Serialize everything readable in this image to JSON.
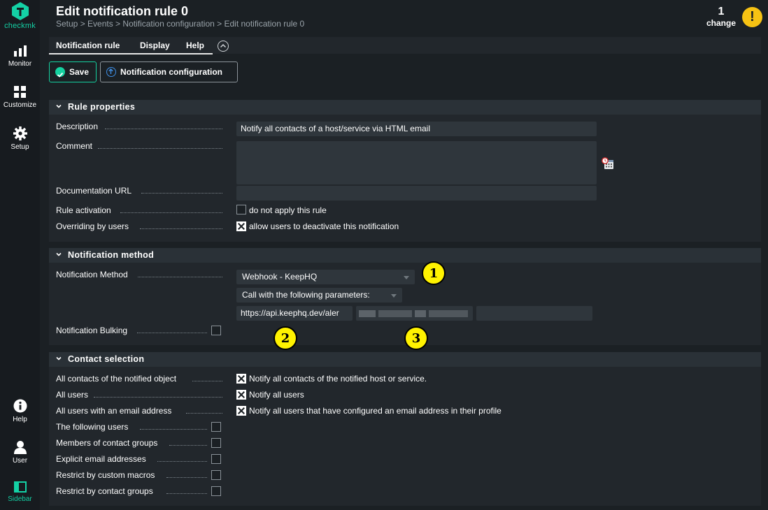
{
  "app": {
    "logo_text": "checkmk"
  },
  "sidebar": {
    "top_items": [
      {
        "label": "Monitor",
        "icon": "bar-chart-icon"
      },
      {
        "label": "Customize",
        "icon": "grid-icon"
      },
      {
        "label": "Setup",
        "icon": "gear-icon"
      }
    ],
    "bottom_items": [
      {
        "label": "Help",
        "icon": "info-icon"
      },
      {
        "label": "User",
        "icon": "user-icon"
      },
      {
        "label": "Sidebar",
        "icon": "sidebar-icon"
      }
    ]
  },
  "header": {
    "title": "Edit notification rule 0",
    "breadcrumb": "Setup > Events > Notification configuration > Edit notification rule 0",
    "changes_count": "1",
    "changes_label": "change"
  },
  "menubar": {
    "items": [
      "Notification rule",
      "Display",
      "Help"
    ]
  },
  "buttons": {
    "save": "Save",
    "config": "Notification configuration"
  },
  "rule_properties": {
    "title": "Rule properties",
    "description_label": "Description",
    "description_value": "Notify all contacts of a host/service via HTML email",
    "comment_label": "Comment",
    "comment_value": "",
    "doc_url_label": "Documentation URL",
    "doc_url_value": "",
    "activation_label": "Rule activation",
    "activation_option": "do not apply this rule",
    "activation_checked": false,
    "overriding_label": "Overriding by users",
    "overriding_option": "allow users to deactivate this notification",
    "overriding_checked": true
  },
  "notification_method": {
    "title": "Notification method",
    "method_label": "Notification Method",
    "method_value": "Webhook - KeepHQ",
    "params_value": "Call with the following parameters:",
    "url_value": "https://api.keephq.dev/aler",
    "bulking_label": "Notification Bulking",
    "bulking_checked": false
  },
  "contact_selection": {
    "title": "Contact selection",
    "rows": [
      {
        "label": "All contacts of the notified object",
        "option": "Notify all contacts of the notified host or service.",
        "checked": true
      },
      {
        "label": "All users",
        "option": "Notify all users",
        "checked": true
      },
      {
        "label": "All users with an email address",
        "option": "Notify all users that have configured an email address in their profile",
        "checked": true
      },
      {
        "label": "The following users",
        "option": "",
        "checked": false
      },
      {
        "label": "Members of contact groups",
        "option": "",
        "checked": false
      },
      {
        "label": "Explicit email addresses",
        "option": "",
        "checked": false
      },
      {
        "label": "Restrict by custom macros",
        "option": "",
        "checked": false
      },
      {
        "label": "Restrict by contact groups",
        "option": "",
        "checked": false
      }
    ]
  },
  "annotations": [
    "1",
    "2",
    "3"
  ],
  "colors": {
    "accent": "#15d1a0",
    "warning": "#f6c213",
    "badge": "#fff200"
  }
}
